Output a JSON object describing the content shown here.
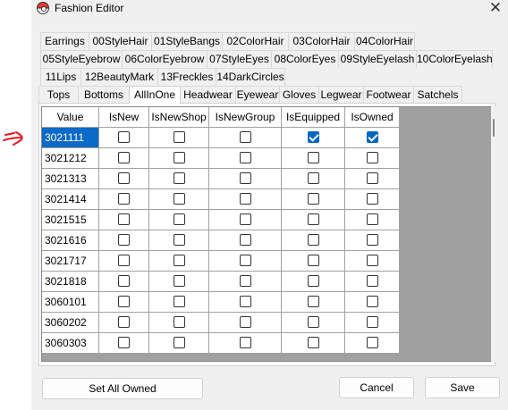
{
  "window": {
    "title": "Fashion Editor",
    "close_glyph": "✕",
    "app_icon": "pokeball-icon"
  },
  "tab_rows": [
    [
      "Earrings",
      "00StyleHair",
      "01StyleBangs",
      "02ColorHair",
      "03ColorHair",
      "04ColorHair"
    ],
    [
      "05StyleEyebrow",
      "06ColorEyebrow",
      "07StyleEyes",
      "08ColorEyes",
      "09StyleEyelash",
      "10ColorEyelash"
    ],
    [
      "11Lips",
      "12BeautyMark",
      "13Freckles",
      "14DarkCircles"
    ],
    [
      "Tops",
      "Bottoms",
      "AllInOne",
      "Headwear",
      "Eyewear",
      "Gloves",
      "Legwear",
      "Footwear",
      "Satchels"
    ]
  ],
  "selected_tab": "AllInOne",
  "grid": {
    "columns": [
      "Value",
      "IsNew",
      "IsNewShop",
      "IsNewGroup",
      "IsEquipped",
      "IsOwned"
    ],
    "rows": [
      {
        "value": "3021111",
        "selected": true,
        "flags": [
          false,
          false,
          false,
          true,
          true
        ]
      },
      {
        "value": "3021212",
        "selected": false,
        "flags": [
          false,
          false,
          false,
          false,
          false
        ]
      },
      {
        "value": "3021313",
        "selected": false,
        "flags": [
          false,
          false,
          false,
          false,
          false
        ]
      },
      {
        "value": "3021414",
        "selected": false,
        "flags": [
          false,
          false,
          false,
          false,
          false
        ]
      },
      {
        "value": "3021515",
        "selected": false,
        "flags": [
          false,
          false,
          false,
          false,
          false
        ]
      },
      {
        "value": "3021616",
        "selected": false,
        "flags": [
          false,
          false,
          false,
          false,
          false
        ]
      },
      {
        "value": "3021717",
        "selected": false,
        "flags": [
          false,
          false,
          false,
          false,
          false
        ]
      },
      {
        "value": "3021818",
        "selected": false,
        "flags": [
          false,
          false,
          false,
          false,
          false
        ]
      },
      {
        "value": "3060101",
        "selected": false,
        "flags": [
          false,
          false,
          false,
          false,
          false
        ]
      },
      {
        "value": "3060202",
        "selected": false,
        "flags": [
          false,
          false,
          false,
          false,
          false
        ]
      },
      {
        "value": "3060303",
        "selected": false,
        "flags": [
          false,
          false,
          false,
          false,
          false
        ]
      }
    ]
  },
  "buttons": {
    "set_all_owned": "Set All Owned",
    "cancel": "Cancel",
    "save": "Save"
  },
  "colors": {
    "selection": "#0a6ac8",
    "checkbox_checked": "#0067c0",
    "annotation_arrow": "#e8141b"
  }
}
